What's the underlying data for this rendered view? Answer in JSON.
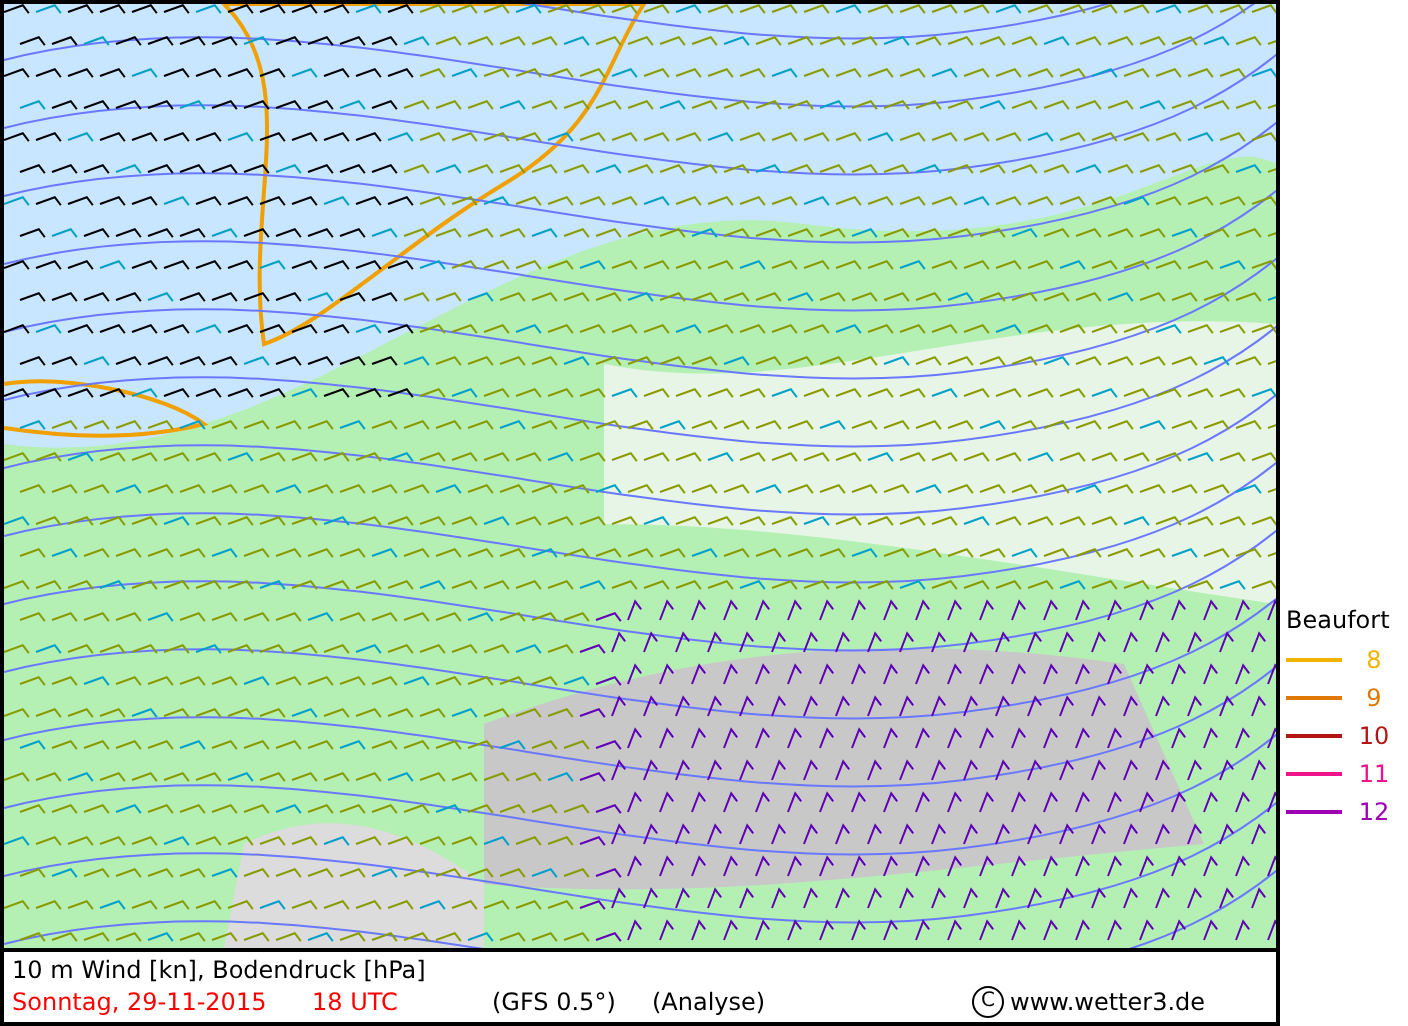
{
  "legend": {
    "title": "Beaufort",
    "items": [
      {
        "label": "8",
        "color": "#f0b400"
      },
      {
        "label": "9",
        "color": "#e07800"
      },
      {
        "label": "10",
        "color": "#b41414"
      },
      {
        "label": "11",
        "color": "#f0148c"
      },
      {
        "label": "12",
        "color": "#a000b4"
      }
    ]
  },
  "caption": {
    "title": "10 m Wind [kn], Bodendruck [hPa]",
    "date": "Sonntag, 29-11-2015",
    "time": "18 UTC",
    "model": "(GFS 0.5°)",
    "run": "(Analyse)",
    "copyright_symbol": "C",
    "site": "www.wetter3.de"
  }
}
